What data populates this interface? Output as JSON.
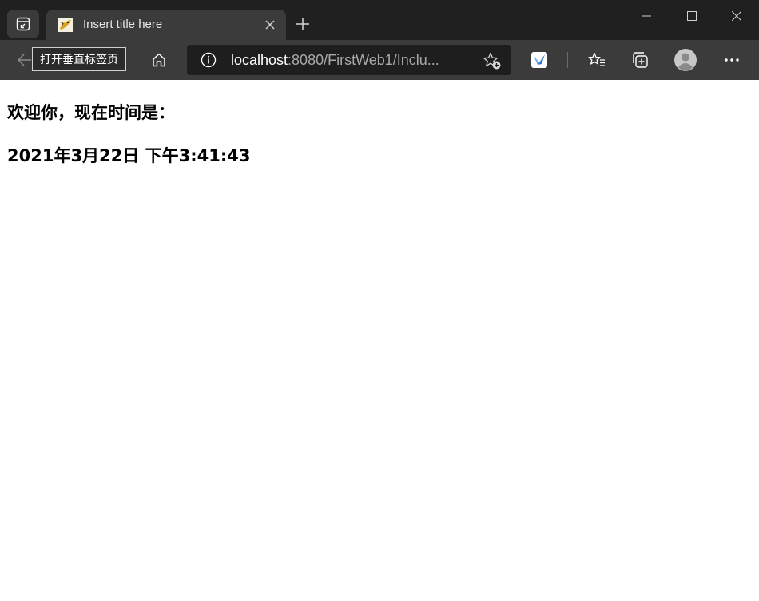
{
  "browser": {
    "tab": {
      "title": "Insert title here",
      "favicon": "tomcat-favicon"
    },
    "new_tab_icon": "plus-icon",
    "window_controls": [
      "minimize-icon",
      "maximize-icon",
      "close-icon"
    ]
  },
  "toolbar": {
    "back_tooltip": "打开垂直标签页",
    "address": {
      "host": "localhost",
      "rest": ":8080/FirstWeb1/Inclu..."
    },
    "icons": [
      "back-arrow-icon",
      "home-icon",
      "site-info-icon",
      "add-favorite-icon",
      "extension-icon",
      "favorites-icon",
      "collections-icon",
      "profile-avatar",
      "more-icon"
    ]
  },
  "page": {
    "welcome": "欢迎你，现在时间是：",
    "datetime": "2021年3月22日 下午3:41:43"
  },
  "colors": {
    "tabstrip_bg": "#202020",
    "toolbar_bg": "#3b3b3b",
    "address_bg": "#1e1e1e",
    "page_bg": "#ffffff",
    "text": "#000000"
  }
}
